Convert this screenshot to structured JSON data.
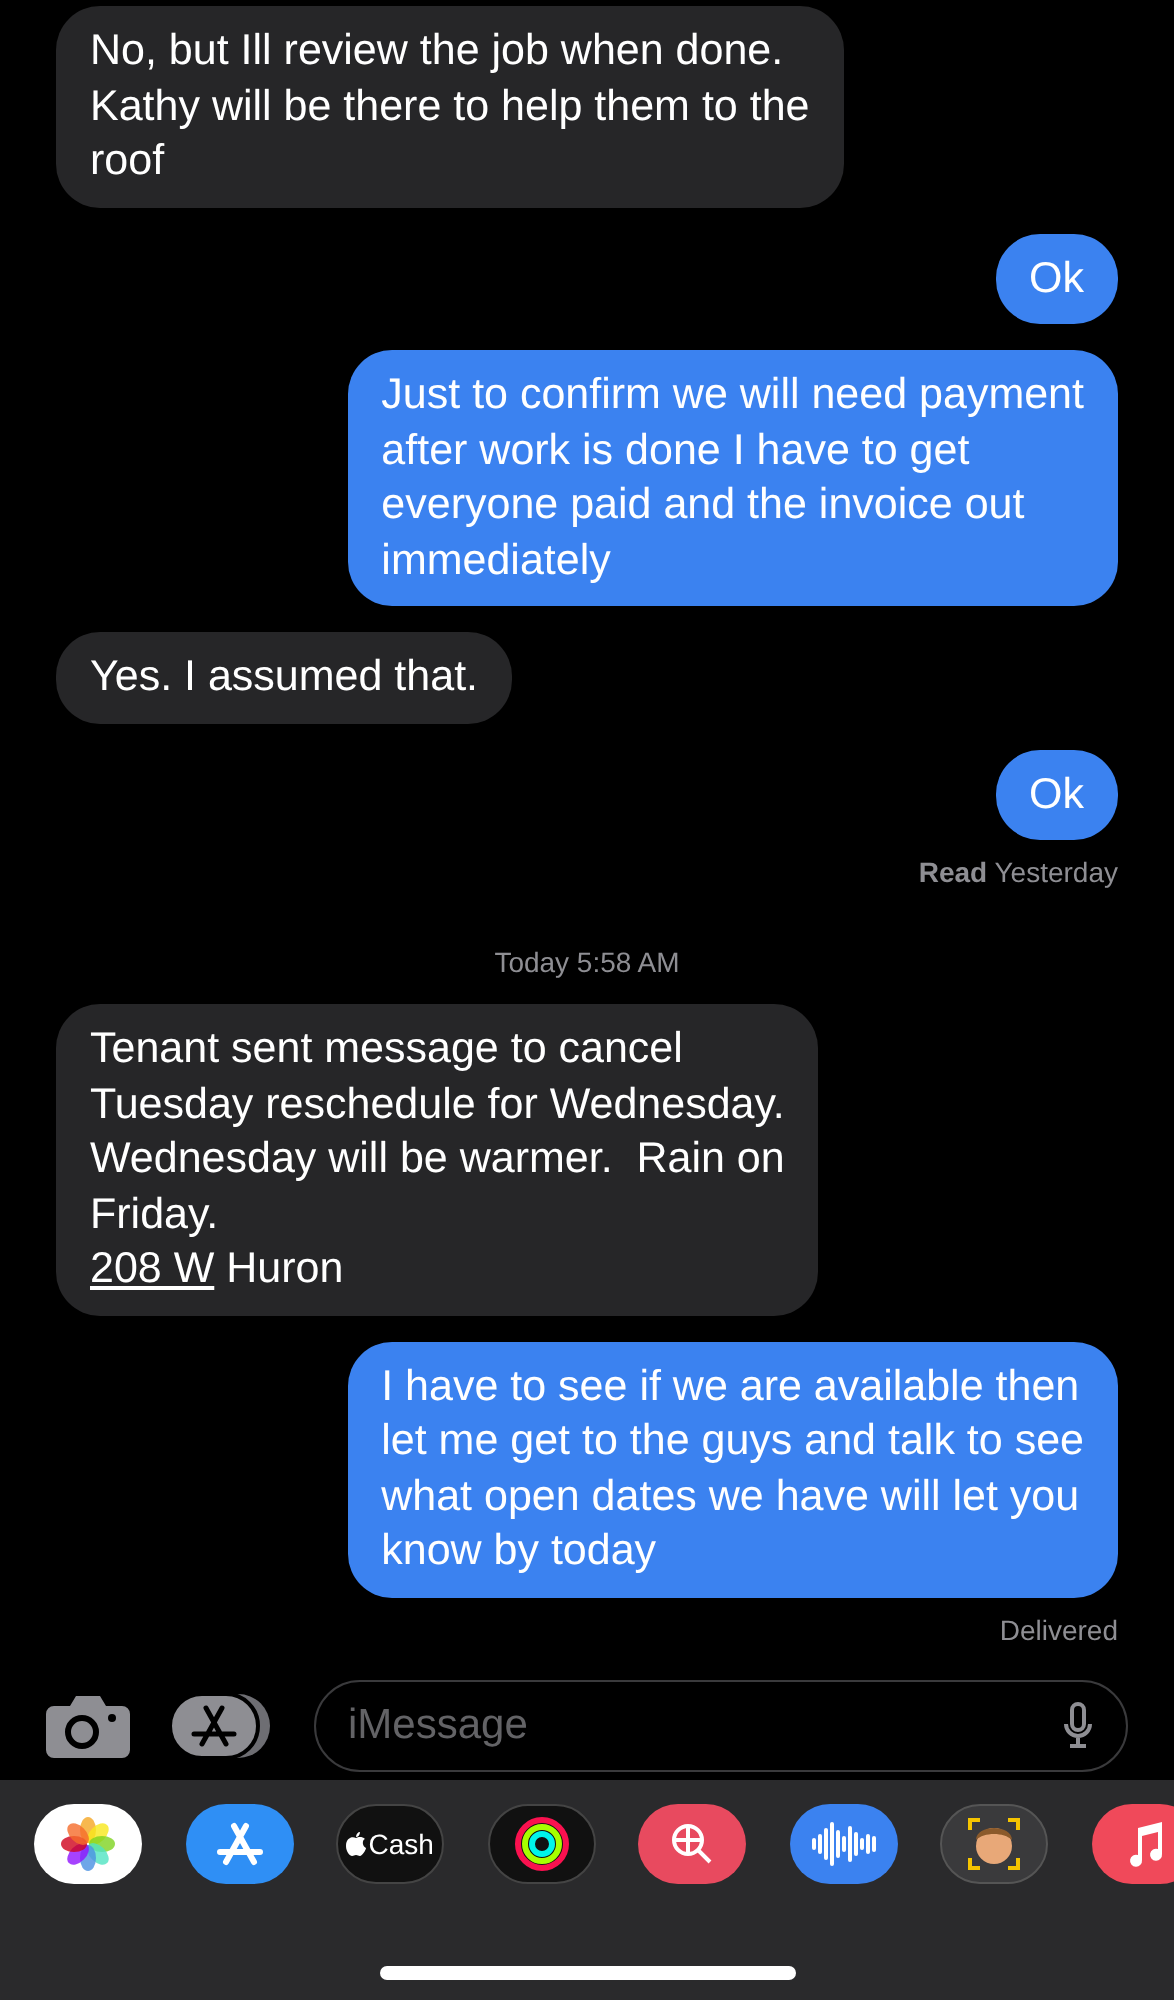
{
  "messages": [
    {
      "kind": "incoming",
      "lines": [
        "No, but Ill review the job when done.",
        "Kathy will be there to help them to the",
        "roof"
      ]
    },
    {
      "kind": "outgoing",
      "lines": [
        "Ok"
      ]
    },
    {
      "kind": "outgoing",
      "lines": [
        "Just to confirm we will need payment",
        "after work is done I have to get",
        "everyone paid and the invoice out",
        "immediately"
      ]
    },
    {
      "kind": "incoming",
      "lines": [
        "Yes. I assumed that."
      ]
    },
    {
      "kind": "outgoing",
      "lines": [
        "Ok"
      ],
      "status": "**Read** Yesterday"
    },
    {
      "kind": "timestamp",
      "text": "Today 5:58 AM"
    },
    {
      "kind": "incoming",
      "lines": [
        "Tenant sent message to cancel",
        "Tuesday reschedule for Wednesday.",
        "Wednesday will be warmer.  Rain on",
        "Friday."
      ],
      "link": "208 W",
      "after_link": "Huron"
    },
    {
      "kind": "outgoing",
      "lines": [
        "I have to see if we are available then",
        "let me get to the guys and talk to see",
        "what open dates we have will let you",
        "know by today"
      ],
      "status": "Delivered"
    }
  ],
  "input": {
    "placeholder": "iMessage"
  },
  "apps": [
    {
      "kind": "photos"
    },
    {
      "kind": "appstore"
    },
    {
      "kind": "cash",
      "label": "Cash"
    },
    {
      "kind": "activity"
    },
    {
      "kind": "search"
    },
    {
      "kind": "audio"
    },
    {
      "kind": "memoji"
    },
    {
      "kind": "music"
    }
  ]
}
